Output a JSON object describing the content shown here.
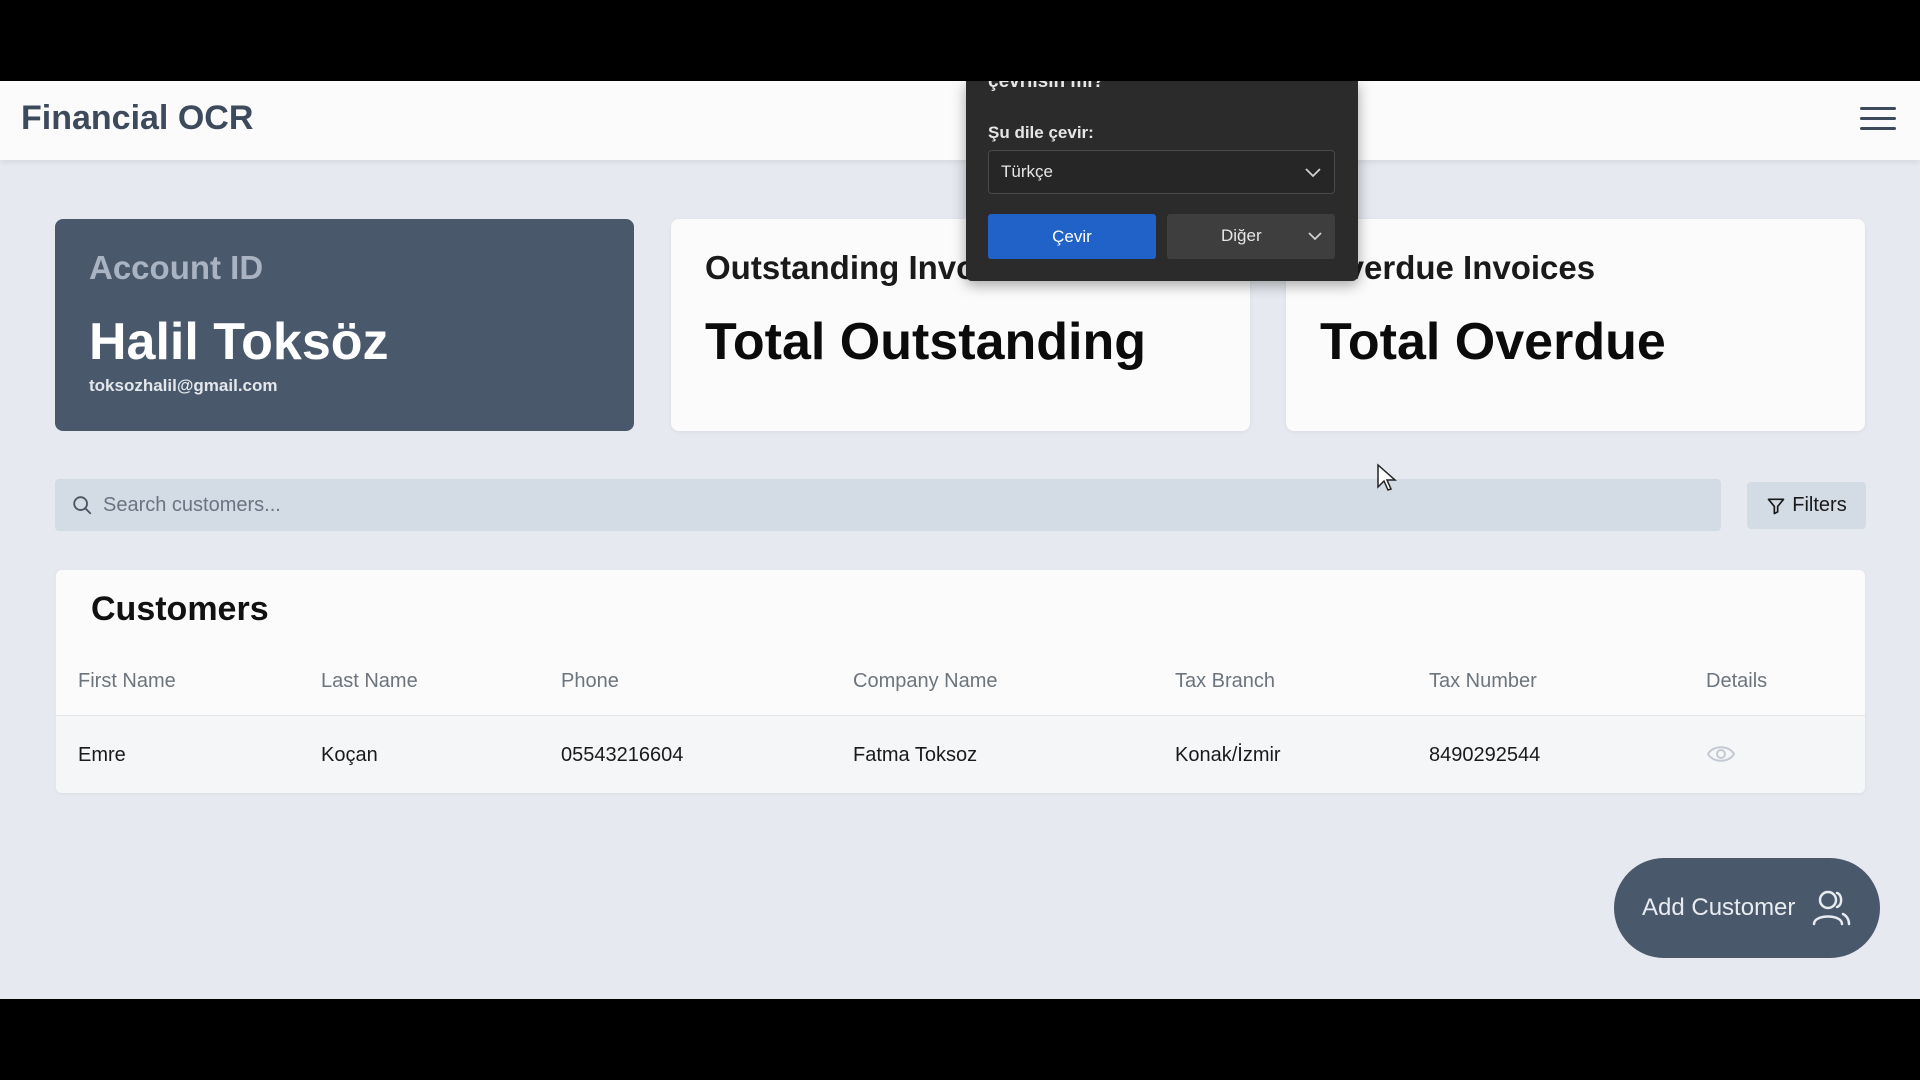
{
  "app": {
    "brand": "Financial OCR"
  },
  "account_card": {
    "label": "Account ID",
    "name": "Halil Toksöz",
    "email": "toksozhalil@gmail.com"
  },
  "outstanding_card": {
    "label": "Outstanding Invoices",
    "value": "Total Outstanding"
  },
  "overdue_card": {
    "label": "Overdue Invoices",
    "value": "Total Overdue"
  },
  "search": {
    "placeholder": "Search customers..."
  },
  "filters_label": "Filters",
  "customers": {
    "title": "Customers",
    "columns": [
      "First Name",
      "Last Name",
      "Phone",
      "Company Name",
      "Tax Branch",
      "Tax Number",
      "Details"
    ],
    "rows": [
      [
        "Emre",
        "Koçan",
        "05543216604",
        "Fatma Toksoz",
        "Konak/İzmir",
        "8490292544"
      ]
    ]
  },
  "add_customer_label": "Add Customer",
  "translate_popup": {
    "title": "çevrilsin mi?",
    "language_label": "Şu dile çevir:",
    "selected_language": "Türkçe",
    "translate_button": "Çevir",
    "more_button": "Diğer"
  },
  "colors": {
    "primary_slate": "#4a586c",
    "background": "#e6eaf0",
    "translate_blue": "#2162c8"
  }
}
